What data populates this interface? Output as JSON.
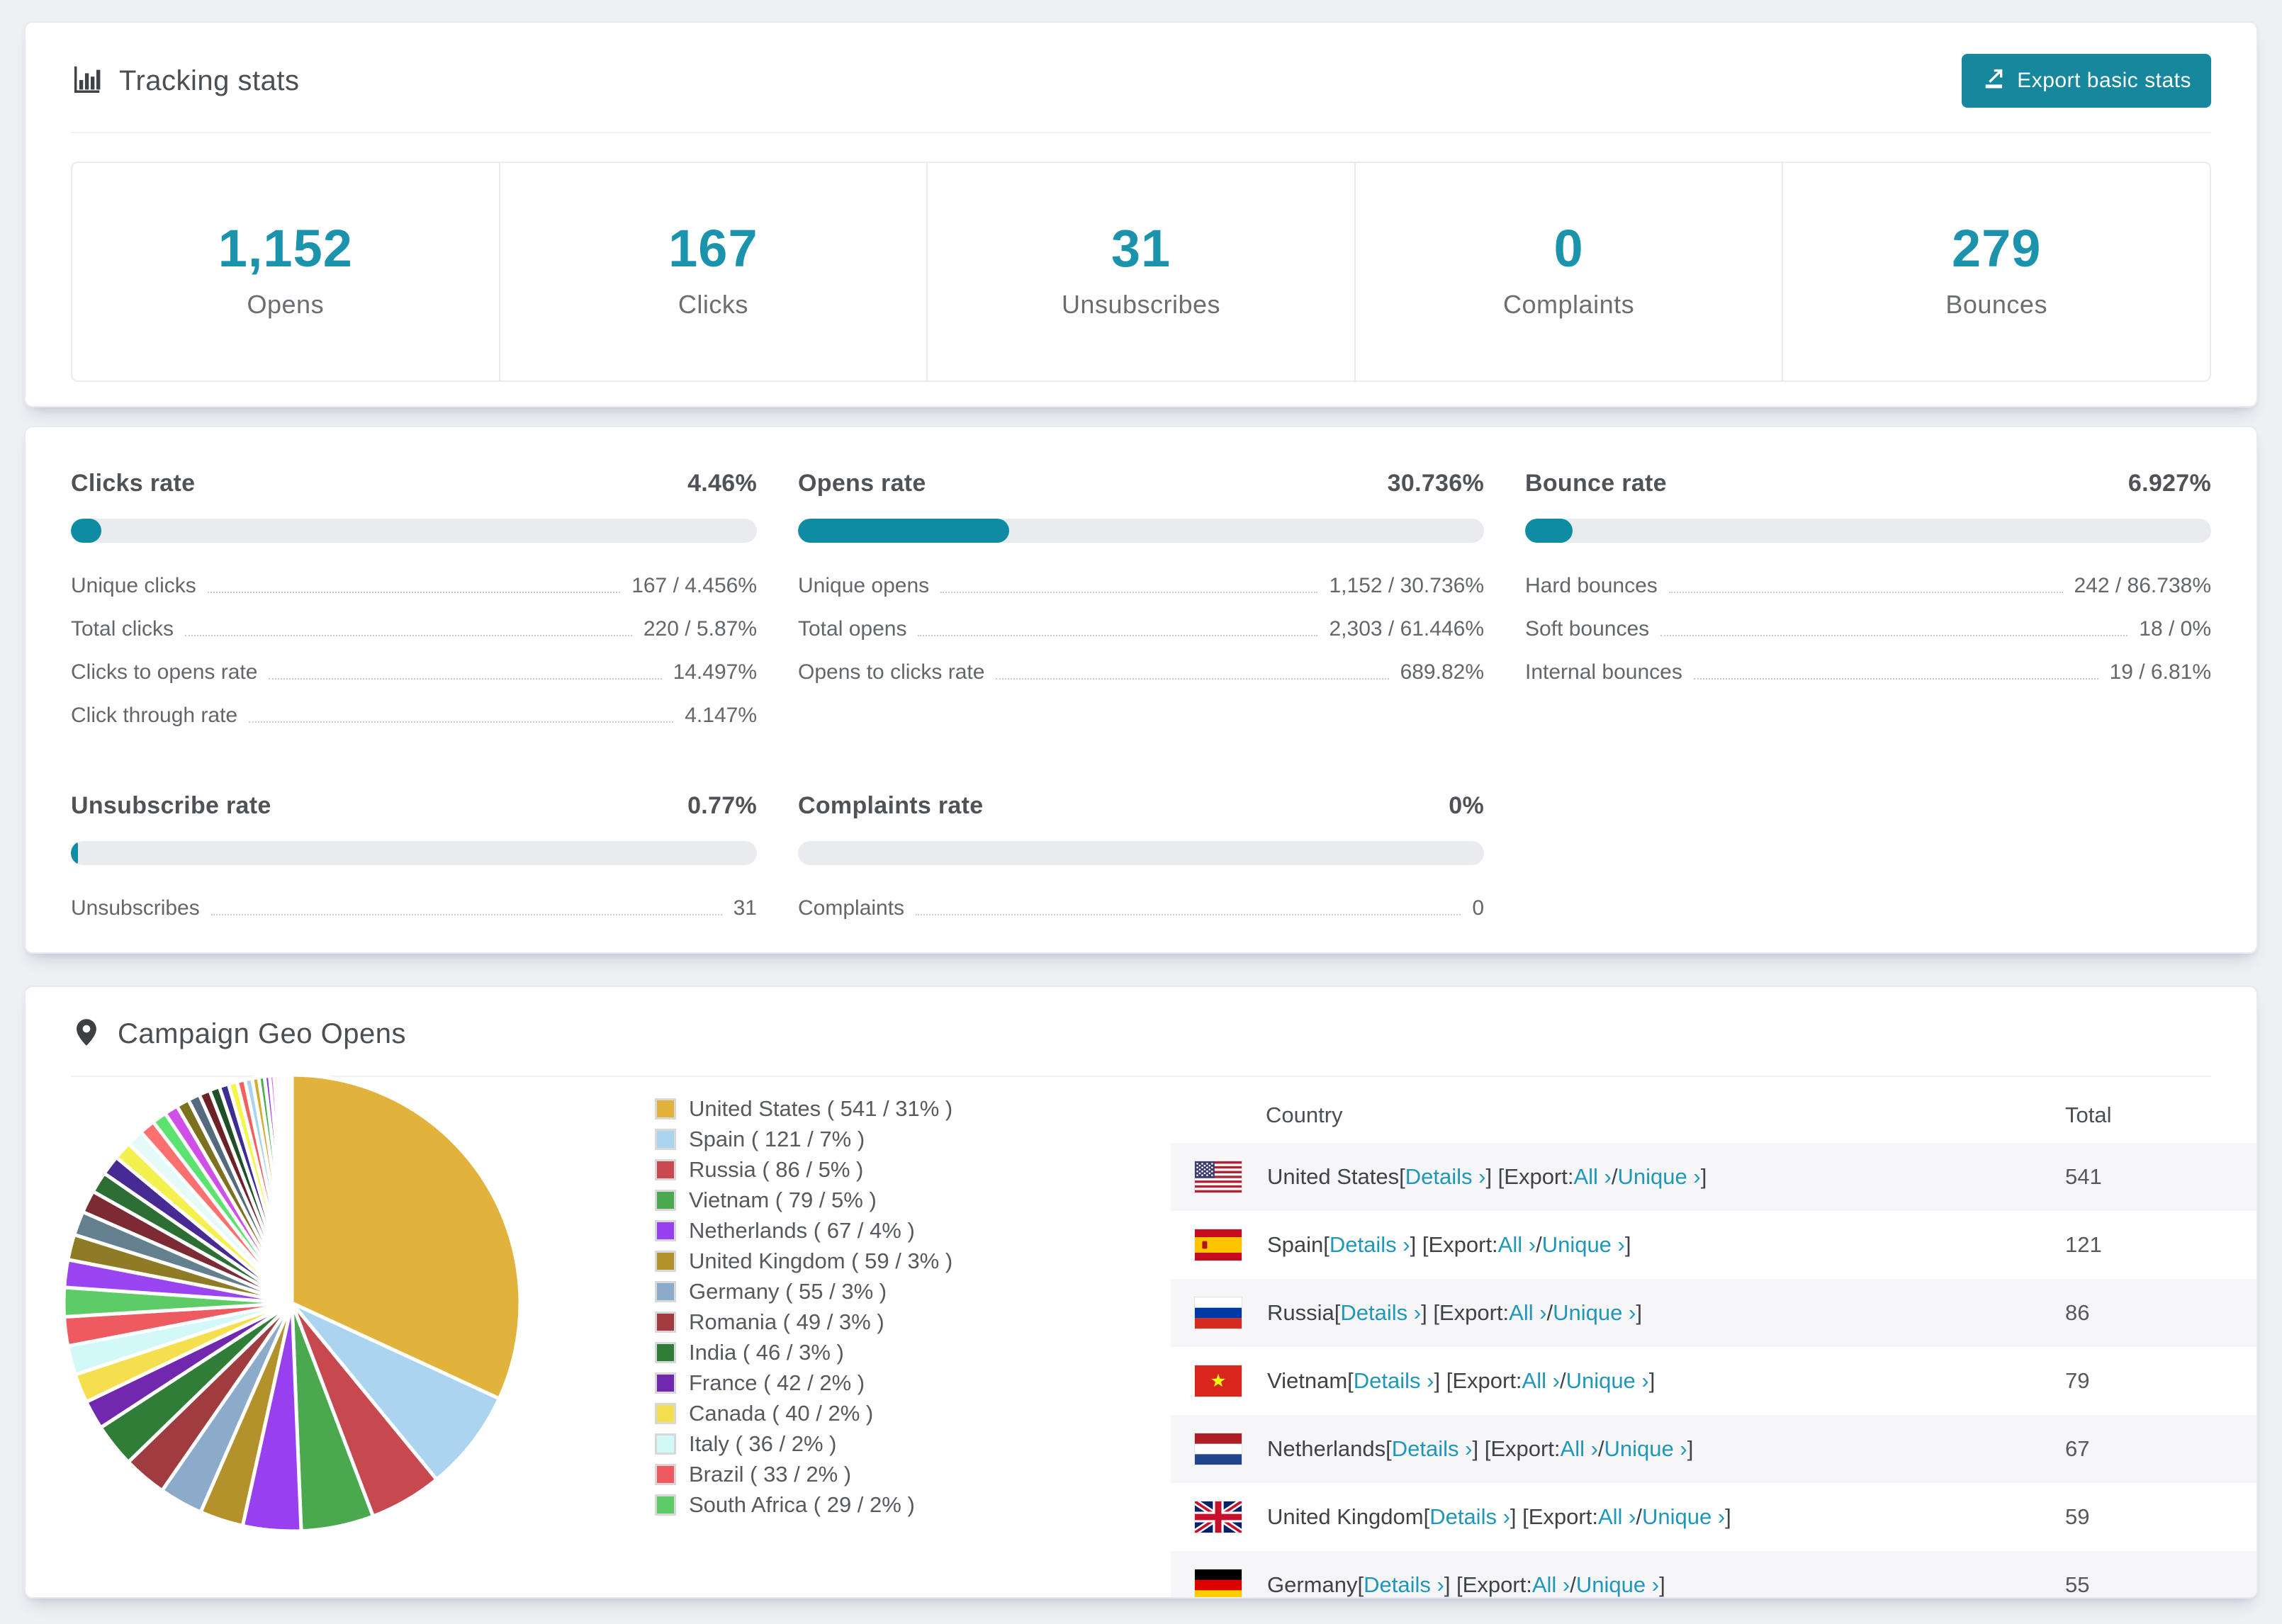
{
  "tracking": {
    "title": "Tracking stats",
    "export_button_label": "Export basic stats",
    "summary": [
      {
        "value": "1,152",
        "label": "Opens"
      },
      {
        "value": "167",
        "label": "Clicks"
      },
      {
        "value": "31",
        "label": "Unsubscribes"
      },
      {
        "value": "0",
        "label": "Complaints"
      },
      {
        "value": "279",
        "label": "Bounces"
      }
    ]
  },
  "rates": {
    "accent_number_color": "#1b93ad",
    "bar_fill_color": "#0f8ca4",
    "bar_track_color": "#e9ebef",
    "sections": [
      {
        "title": "Clicks rate",
        "value": "4.46%",
        "percent": 4.46,
        "rows": [
          {
            "label": "Unique clicks",
            "value": "167 / 4.456%"
          },
          {
            "label": "Total clicks",
            "value": "220 / 5.87%"
          },
          {
            "label": "Clicks to opens rate",
            "value": "14.497%"
          },
          {
            "label": "Click through rate",
            "value": "4.147%"
          }
        ]
      },
      {
        "title": "Opens rate",
        "value": "30.736%",
        "percent": 30.736,
        "rows": [
          {
            "label": "Unique opens",
            "value": "1,152 / 30.736%"
          },
          {
            "label": "Total opens",
            "value": "2,303 / 61.446%"
          },
          {
            "label": "Opens to clicks rate",
            "value": "689.82%"
          }
        ]
      },
      {
        "title": "Bounce rate",
        "value": "6.927%",
        "percent": 6.927,
        "rows": [
          {
            "label": "Hard bounces",
            "value": "242 / 86.738%"
          },
          {
            "label": "Soft bounces",
            "value": "18 / 0%"
          },
          {
            "label": "Internal bounces",
            "value": "19 / 6.81%"
          }
        ]
      },
      {
        "title": "Unsubscribe rate",
        "value": "0.77%",
        "percent": 0.77,
        "rows": [
          {
            "label": "Unsubscribes",
            "value": "31"
          }
        ]
      },
      {
        "title": "Complaints rate",
        "value": "0%",
        "percent": 0,
        "rows": [
          {
            "label": "Complaints",
            "value": "0"
          }
        ]
      }
    ]
  },
  "geo": {
    "title": "Campaign Geo Opens",
    "chart_data": {
      "type": "pie",
      "title": "Campaign Geo Opens",
      "unit": "opens",
      "start_angle_deg": 0,
      "direction": "clockwise",
      "legend_position": "right",
      "slices": [
        {
          "label": "United States",
          "value": 541,
          "pct": 31,
          "color": "#e2b33c"
        },
        {
          "label": "Spain",
          "value": 121,
          "pct": 7,
          "color": "#abd4f0"
        },
        {
          "label": "Russia",
          "value": 86,
          "pct": 5,
          "color": "#c7484f"
        },
        {
          "label": "Vietnam",
          "value": 79,
          "pct": 5,
          "color": "#4aa84e"
        },
        {
          "label": "Netherlands",
          "value": 67,
          "pct": 4,
          "color": "#9840ef"
        },
        {
          "label": "United Kingdom",
          "value": 59,
          "pct": 3,
          "color": "#b3912b"
        },
        {
          "label": "Germany",
          "value": 55,
          "pct": 3,
          "color": "#8cabca"
        },
        {
          "label": "Romania",
          "value": 49,
          "pct": 3,
          "color": "#a03c40"
        },
        {
          "label": "India",
          "value": 46,
          "pct": 3,
          "color": "#2f7d36"
        },
        {
          "label": "France",
          "value": 42,
          "pct": 2,
          "color": "#7127ae"
        },
        {
          "label": "Canada",
          "value": 40,
          "pct": 2,
          "color": "#f6df4d"
        },
        {
          "label": "Italy",
          "value": 36,
          "pct": 2,
          "color": "#d2f9f7"
        },
        {
          "label": "Brazil",
          "value": 33,
          "pct": 2,
          "color": "#ed5a60"
        },
        {
          "label": "South Africa",
          "value": 29,
          "pct": 2,
          "color": "#5ecc66"
        }
      ],
      "other_slices": [
        {
          "pct": 1.9,
          "color": "#9b45f2"
        },
        {
          "pct": 1.75,
          "color": "#8f7b26"
        },
        {
          "pct": 1.65,
          "color": "#64808f"
        },
        {
          "pct": 1.55,
          "color": "#7c2a33"
        },
        {
          "pct": 1.45,
          "color": "#2c6e33"
        },
        {
          "pct": 1.35,
          "color": "#472a93"
        },
        {
          "pct": 1.25,
          "color": "#f4f04d"
        },
        {
          "pct": 1.15,
          "color": "#e4fbf9"
        },
        {
          "pct": 1.08,
          "color": "#fc7070"
        },
        {
          "pct": 1.0,
          "color": "#5ce26e"
        },
        {
          "pct": 0.94,
          "color": "#cf4fe8"
        },
        {
          "pct": 0.88,
          "color": "#7d701f"
        },
        {
          "pct": 0.82,
          "color": "#536b7d"
        },
        {
          "pct": 0.76,
          "color": "#6e2127"
        },
        {
          "pct": 0.7,
          "color": "#1f4f26"
        },
        {
          "pct": 0.65,
          "color": "#3b2d91"
        },
        {
          "pct": 0.6,
          "color": "#f6f649"
        },
        {
          "pct": 0.55,
          "color": "#f25f5f"
        },
        {
          "pct": 0.5,
          "color": "#a9d3f2"
        },
        {
          "pct": 0.45,
          "color": "#d8a930"
        },
        {
          "pct": 0.4,
          "color": "#43b04c"
        },
        {
          "pct": 0.35,
          "color": "#8d35ea"
        },
        {
          "pct": 0.3,
          "color": "#e14fe1"
        },
        {
          "pct": 0.26,
          "color": "#f08a8a"
        },
        {
          "pct": 0.22,
          "color": "#bdf2bd"
        },
        {
          "pct": 0.18,
          "color": "#cdb0f5"
        },
        {
          "pct": 0.15,
          "color": "#f5cde8"
        },
        {
          "pct": 0.12,
          "color": "#cde8cd"
        },
        {
          "pct": 0.1,
          "color": "#b5e3f7"
        },
        {
          "pct": 0.08,
          "color": "#e3c2ea"
        },
        {
          "pct": 0.06,
          "color": "#f7e3bd"
        },
        {
          "pct": 0.05,
          "color": "#f7c6cd"
        }
      ]
    },
    "legend_format": {
      "open": "( ",
      "mid": " / ",
      "close": "% )"
    },
    "table": {
      "headers": {
        "country": "Country",
        "total": "Total"
      },
      "links": {
        "details": "Details ›",
        "export_prefix": "Export:",
        "all": "All ›",
        "unique": "Unique ›"
      },
      "punct": {
        "open": " [",
        "close": "] ",
        "open2": "[",
        "slash": " / ",
        "end": "]"
      },
      "rows": [
        {
          "country": "United States",
          "flag": "us",
          "total": "541"
        },
        {
          "country": "Spain",
          "flag": "es",
          "total": "121"
        },
        {
          "country": "Russia",
          "flag": "ru",
          "total": "86"
        },
        {
          "country": "Vietnam",
          "flag": "vn",
          "total": "79"
        },
        {
          "country": "Netherlands",
          "flag": "nl",
          "total": "67"
        },
        {
          "country": "United Kingdom",
          "flag": "gb",
          "total": "59"
        },
        {
          "country": "Germany",
          "flag": "de",
          "total": "55"
        }
      ]
    }
  }
}
